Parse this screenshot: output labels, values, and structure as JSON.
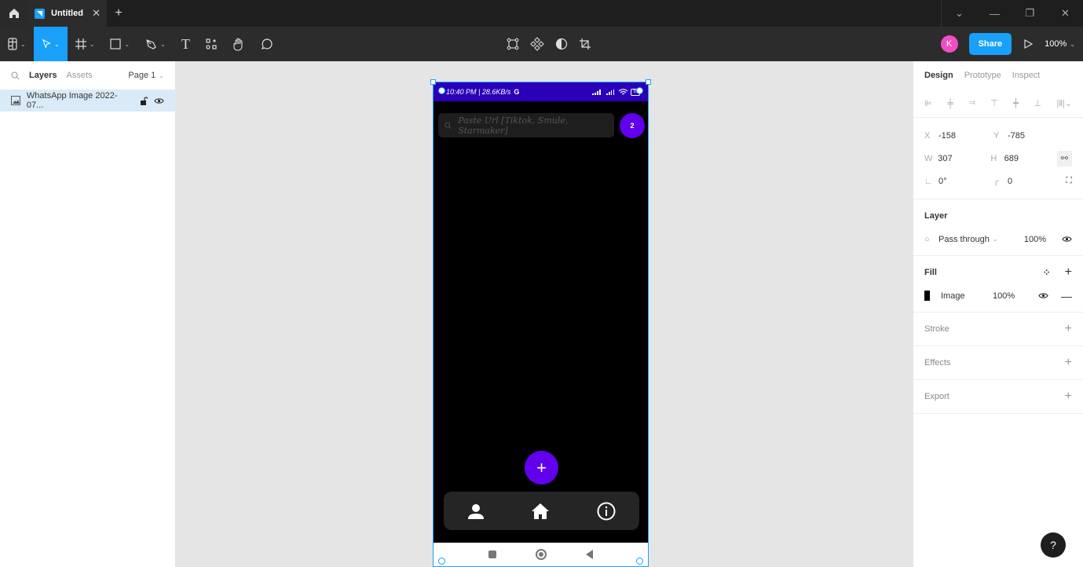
{
  "titlebar": {
    "tab_title": "Untitled",
    "close_glyph": "✕",
    "new_tab_glyph": "+"
  },
  "window_controls": {
    "menu": "⌄",
    "minimize": "—",
    "restore": "❐",
    "close": "✕"
  },
  "toolbar": {
    "tools": [
      "main-menu",
      "move",
      "frame",
      "shape",
      "pen",
      "text",
      "resources",
      "hand",
      "comment"
    ],
    "text_glyph": "T",
    "center_tools": [
      "edit-object",
      "component",
      "mask",
      "crop"
    ],
    "avatar_initial": "K",
    "share_label": "Share",
    "zoom_level": "100%"
  },
  "left_panel": {
    "tabs": {
      "layers": "Layers",
      "assets": "Assets"
    },
    "page": "Page 1",
    "layers": [
      {
        "name": "WhatsApp Image 2022-07...",
        "type": "image"
      }
    ]
  },
  "phone": {
    "status_time": "10:40 PM | 28.6KB/s",
    "status_net": "G",
    "battery": "59",
    "search_placeholder": "Paste Url [Tiktok, Smule, Starmaker]",
    "badge": "2",
    "fab": "+",
    "nav": [
      "person",
      "home",
      "info"
    ]
  },
  "right_panel": {
    "tabs": {
      "design": "Design",
      "prototype": "Prototype",
      "inspect": "Inspect"
    },
    "x": "-158",
    "y": "-785",
    "w": "307",
    "h": "689",
    "rotation": "0°",
    "radius": "0",
    "labels": {
      "x": "X",
      "y": "Y",
      "w": "W",
      "h": "H"
    },
    "layer": {
      "title": "Layer",
      "blend": "Pass through",
      "opacity": "100%"
    },
    "fill": {
      "title": "Fill",
      "type": "Image",
      "opacity": "100%"
    },
    "stroke": "Stroke",
    "effects": "Effects",
    "export": "Export"
  },
  "help": "?"
}
